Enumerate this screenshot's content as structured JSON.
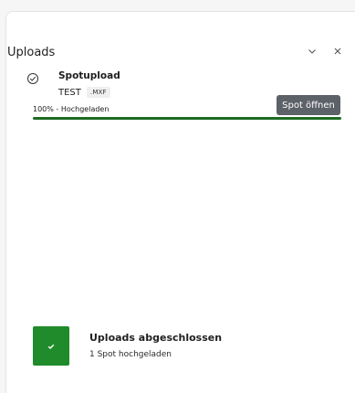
{
  "header": {
    "title": "Uploads",
    "collapse_icon": "chevron-down-icon",
    "close_icon": "close-icon"
  },
  "upload": {
    "name": "Spotupload",
    "file": "TEST",
    "extension": ".MXF",
    "status": "100% - Hochgeladen",
    "progress": 1.0,
    "open_button_label": "Spot öffnen",
    "status_icon": "check-circle-icon"
  },
  "summary": {
    "title": "Uploads abgeschlossen",
    "subtitle": "1 Spot hochgeladen",
    "icon": "checkmark-icon"
  },
  "colors": {
    "progress": "#1d6b23",
    "success": "#1f8b2b",
    "button": "#5d6168"
  }
}
